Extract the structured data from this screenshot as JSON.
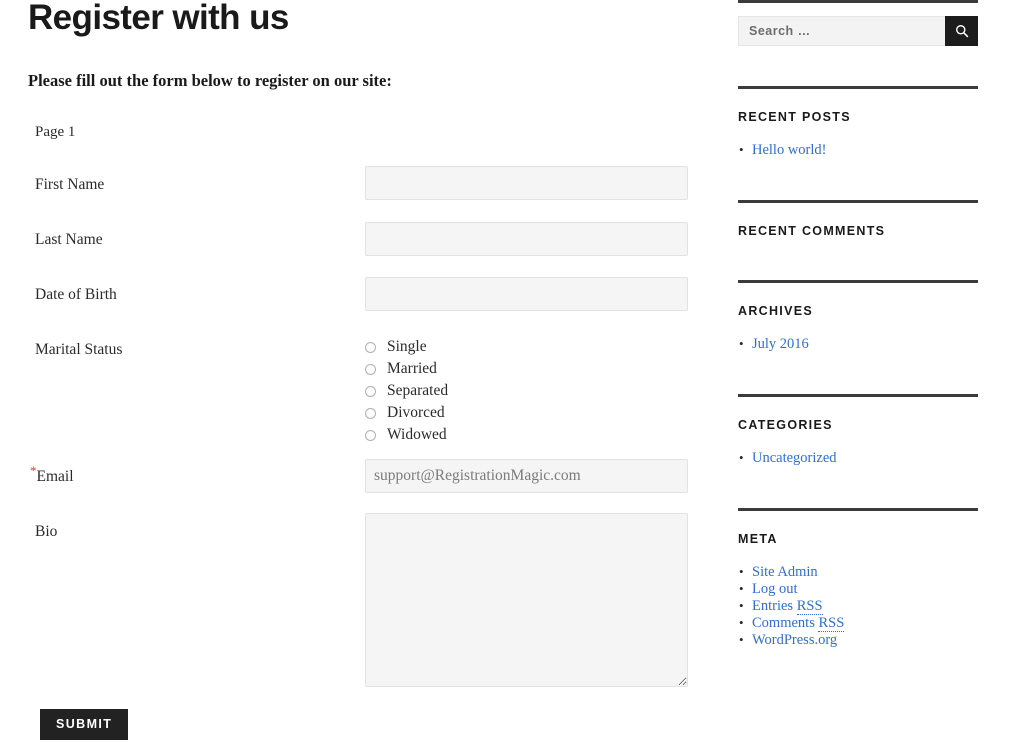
{
  "page": {
    "title": "Register with us",
    "intro": "Please fill out the form below to register on our site:",
    "page_label": "Page 1",
    "submit_label": "SUBMIT",
    "required_marker": "*",
    "accent_link_color": "#2f6fd0",
    "submit_bg_color": "#222222"
  },
  "form": {
    "fields": [
      {
        "label": "First Name",
        "type": "text",
        "value": "",
        "placeholder": ""
      },
      {
        "label": "Last Name",
        "type": "text",
        "value": "",
        "placeholder": ""
      },
      {
        "label": "Date of Birth",
        "type": "text",
        "value": "",
        "placeholder": ""
      },
      {
        "label": "Marital Status",
        "type": "radio",
        "value": "",
        "placeholder": ""
      },
      {
        "label": "Email",
        "type": "email",
        "value": "",
        "placeholder": "support@RegistrationMagic.com",
        "required": true
      },
      {
        "label": "Bio",
        "type": "textarea",
        "value": "",
        "placeholder": ""
      }
    ],
    "marital_status_options": [
      "Single",
      "Married",
      "Separated",
      "Divorced",
      "Widowed"
    ]
  },
  "sidebar": {
    "search": {
      "placeholder": "Search …",
      "value": "",
      "button_icon": "search-icon"
    },
    "widgets": [
      {
        "title": "RECENT POSTS",
        "items": [
          {
            "label": "Hello world!"
          }
        ]
      },
      {
        "title": "RECENT COMMENTS",
        "items": []
      },
      {
        "title": "ARCHIVES",
        "items": [
          {
            "label": "July 2016"
          }
        ]
      },
      {
        "title": "CATEGORIES",
        "items": [
          {
            "label": "Uncategorized"
          }
        ]
      },
      {
        "title": "META",
        "items": [
          {
            "label": "Site Admin"
          },
          {
            "label": "Log out"
          },
          {
            "label": "Entries RSS",
            "abbr": "RSS"
          },
          {
            "label": "Comments RSS",
            "abbr": "RSS"
          },
          {
            "label": "WordPress.org"
          }
        ]
      }
    ]
  }
}
